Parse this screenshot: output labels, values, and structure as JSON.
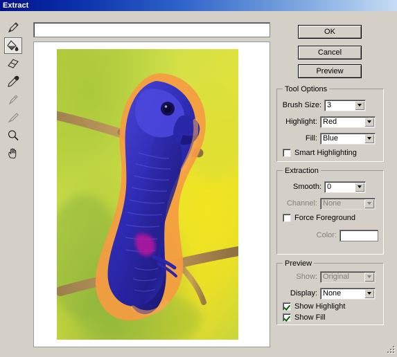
{
  "window": {
    "title": "Extract",
    "accent": "#00128b"
  },
  "buttons": {
    "ok": "OK",
    "cancel": "Cancel",
    "preview": "Preview"
  },
  "tools": [
    {
      "name": "edge-highlighter-tool",
      "selected": false
    },
    {
      "name": "fill-tool",
      "selected": true
    },
    {
      "name": "eraser-tool",
      "selected": false
    },
    {
      "name": "eyedropper-tool",
      "selected": false
    },
    {
      "name": "cleanup-tool",
      "selected": false
    },
    {
      "name": "edge-touchup-tool",
      "selected": false
    },
    {
      "name": "zoom-tool",
      "selected": false
    },
    {
      "name": "hand-tool",
      "selected": false
    }
  ],
  "tool_options": {
    "title": "Tool Options",
    "brush_size": {
      "label": "Brush Size:",
      "value": "3"
    },
    "highlight": {
      "label": "Highlight:",
      "value": "Red"
    },
    "fill": {
      "label": "Fill:",
      "value": "Blue"
    },
    "smart_highlighting": {
      "label": "Smart Highlighting",
      "checked": false
    }
  },
  "extraction": {
    "title": "Extraction",
    "smooth": {
      "label": "Smooth:",
      "value": "0"
    },
    "channel": {
      "label": "Channel:",
      "value": "None",
      "disabled": true
    },
    "force_foreground": {
      "label": "Force Foreground",
      "checked": false
    },
    "color": {
      "label": "Color:",
      "value": "#ffffff",
      "disabled": true
    }
  },
  "preview": {
    "title": "Preview",
    "show": {
      "label": "Show:",
      "value": "Original",
      "disabled": true
    },
    "display": {
      "label": "Display:",
      "value": "None"
    },
    "show_highlight": {
      "label": "Show Highlight",
      "checked": true
    },
    "show_fill": {
      "label": "Show Fill",
      "checked": true
    }
  },
  "canvas": {
    "name": "extract-preview-canvas",
    "highlight_color": "#f59b42",
    "fill_color": "#3a35c8"
  }
}
